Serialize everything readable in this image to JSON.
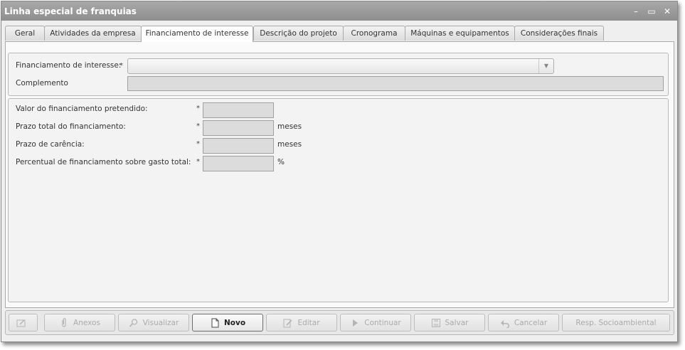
{
  "window": {
    "title": "Linha especial de franquias",
    "controls": {
      "minimize": "–",
      "maximize": "▭",
      "close": "✕"
    }
  },
  "tabs": [
    {
      "label": "Geral",
      "active": false
    },
    {
      "label": "Atividades da empresa",
      "active": false
    },
    {
      "label": "Financiamento de interesse",
      "active": true
    },
    {
      "label": "Descrição do projeto",
      "active": false
    },
    {
      "label": "Cronograma",
      "active": false
    },
    {
      "label": "Máquinas e equipamentos",
      "active": false
    },
    {
      "label": "Considerações finais",
      "active": false
    }
  ],
  "form": {
    "financiamento": {
      "label": "Financiamento de interesse:",
      "required_mark": "*",
      "value": ""
    },
    "complemento": {
      "label": "Complemento",
      "value": ""
    },
    "valor": {
      "label": "Valor do financiamento pretendido:",
      "required_mark": "*",
      "value": ""
    },
    "prazo_total": {
      "label": "Prazo total do financiamento:",
      "required_mark": "*",
      "value": "",
      "unit": "meses"
    },
    "prazo_carencia": {
      "label": "Prazo de carência:",
      "required_mark": "*",
      "value": "",
      "unit": "meses"
    },
    "percentual": {
      "label": "Percentual de financiamento sobre gasto total:",
      "required_mark": "*",
      "value": "",
      "unit": "%"
    }
  },
  "toolbar": {
    "buttons": [
      {
        "label": "",
        "icon": "edit-page-icon",
        "enabled": false
      },
      {
        "label": "Anexos",
        "icon": "paperclip-icon",
        "enabled": false
      },
      {
        "label": "Visualizar",
        "icon": "magnifier-icon",
        "enabled": false
      },
      {
        "label": "Novo",
        "icon": "new-document-icon",
        "enabled": true
      },
      {
        "label": "Editar",
        "icon": "pencil-icon",
        "enabled": false
      },
      {
        "label": "Continuar",
        "icon": "play-icon",
        "enabled": false
      },
      {
        "label": "Salvar",
        "icon": "floppy-icon",
        "enabled": false
      },
      {
        "label": "Cancelar",
        "icon": "undo-icon",
        "enabled": false
      },
      {
        "label": "Resp. Socioambiental",
        "icon": "",
        "enabled": false
      }
    ]
  }
}
